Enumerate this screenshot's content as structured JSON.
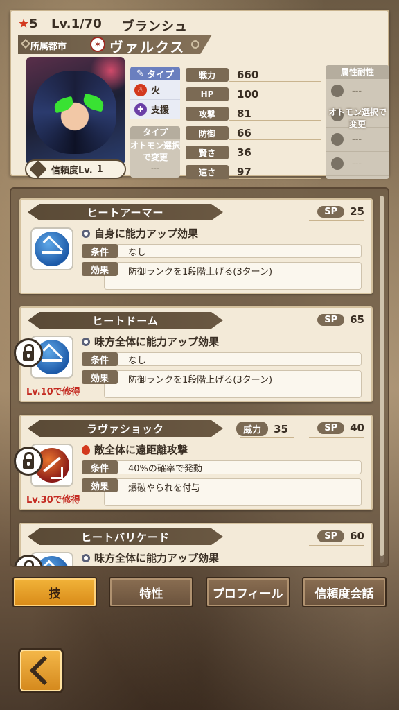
{
  "header": {
    "rarity": "5",
    "level": "Lv.1/70",
    "character_en": "ブランシュ",
    "city_label": "所属都市",
    "character_name": "ヴァルクス",
    "trust_label": "信頼度Lv.",
    "trust_level": "1"
  },
  "type": {
    "title": "タイプ",
    "element": "火",
    "role": "支援",
    "slot2_title": "タイプ",
    "slot2_text": "オトモン選択で変更",
    "slot2_value": "---"
  },
  "stats": [
    {
      "label": "戦力",
      "value": "660"
    },
    {
      "label": "HP",
      "value": "100"
    },
    {
      "label": "攻撃",
      "value": "81"
    },
    {
      "label": "防御",
      "value": "66"
    },
    {
      "label": "賢さ",
      "value": "36"
    },
    {
      "label": "速さ",
      "value": "97"
    }
  ],
  "resistance": {
    "title": "属性耐性",
    "overlay": "オトモン選択で変更",
    "values": [
      "---",
      "---",
      "---",
      "---"
    ]
  },
  "skills": [
    {
      "name": "ヒートアーマー",
      "sp_label": "SP",
      "sp": "25",
      "desc": "自身に能力アップ効果",
      "cond_label": "条件",
      "cond": "なし",
      "effect_label": "効果",
      "effect": "防御ランクを1段階上げる(3ターン)"
    },
    {
      "name": "ヒートドーム",
      "sp_label": "SP",
      "sp": "65",
      "desc": "味方全体に能力アップ効果",
      "cond_label": "条件",
      "cond": "なし",
      "effect_label": "効果",
      "effect": "防御ランクを1段階上げる(3ターン)",
      "unlock": "Lv.10で修得"
    },
    {
      "name": "ラヴァショック",
      "power_label": "威力",
      "power": "35",
      "sp_label": "SP",
      "sp": "40",
      "desc": "敵全体に遠距離攻撃",
      "cond_label": "条件",
      "cond": "40%の確率で発動",
      "effect_label": "効果",
      "effect": "爆破やられを付与",
      "unlock": "Lv.30で修得"
    },
    {
      "name": "ヒートバリケード",
      "sp_label": "SP",
      "sp": "60",
      "desc": "味方全体に能力アップ効果"
    }
  ],
  "tabs": [
    "技",
    "特性",
    "プロフィール",
    "信頼度会話"
  ],
  "colors": {
    "accent_gold": "#f2b43a",
    "card_bg": "#f3ead8",
    "label_brown": "#7b6a54",
    "unlock_red": "#c42b22"
  }
}
